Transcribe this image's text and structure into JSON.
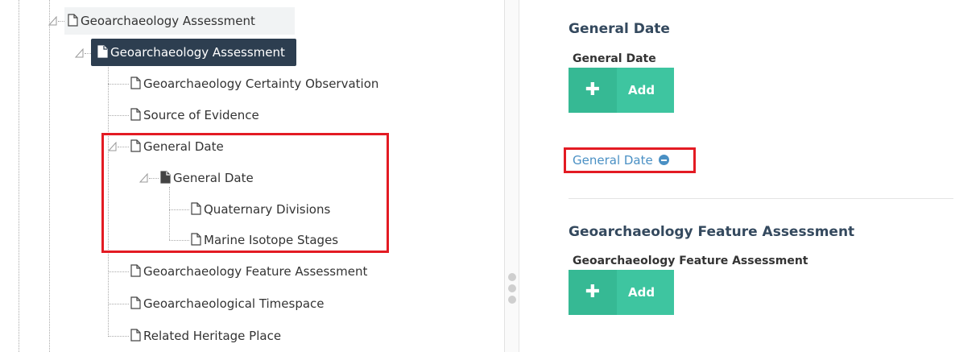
{
  "tree": {
    "nodes": [
      {
        "label": "Geoarchaeology Assessment"
      },
      {
        "label": "Geoarchaeology Assessment"
      },
      {
        "label": "Geoarchaeology Certainty Observation"
      },
      {
        "label": "Source of Evidence"
      },
      {
        "label": "General Date"
      },
      {
        "label": "General Date"
      },
      {
        "label": "Quaternary Divisions"
      },
      {
        "label": "Marine Isotope Stages"
      },
      {
        "label": "Geoarchaeology Feature Assessment"
      },
      {
        "label": "Geoarchaeological Timespace"
      },
      {
        "label": "Related Heritage Place"
      }
    ]
  },
  "form": {
    "sections": [
      {
        "title": "General Date",
        "field_label": "General Date",
        "add_label": "Add"
      },
      {
        "title": "Geoarchaeology Feature Assessment",
        "field_label": "Geoarchaeology Feature Assessment",
        "add_label": "Add"
      }
    ],
    "card_link": {
      "label": "General Date"
    }
  },
  "colors": {
    "selected_bg": "#2d3e50",
    "add_button": "#3ec5a0",
    "highlight": "#e31b23",
    "link": "#4a90c4",
    "section_title": "#34495e"
  },
  "icons": {
    "page": "file-outline-icon",
    "page_selected": "file-filled-icon",
    "expander": "expanded-triangle-icon",
    "add": "plus-icon",
    "remove": "minus-circle-icon"
  }
}
